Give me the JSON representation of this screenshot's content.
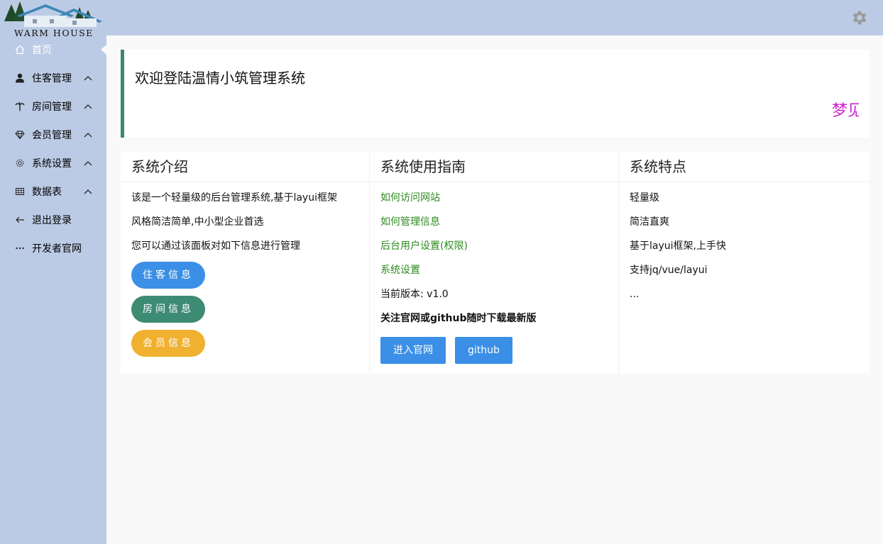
{
  "logo": {
    "text": "WARM HOUSE"
  },
  "sidebar": {
    "items": [
      {
        "label": "首页",
        "icon": "home-icon",
        "active": true
      },
      {
        "label": "住客管理",
        "icon": "user-icon",
        "expandable": true
      },
      {
        "label": "房间管理",
        "icon": "palm-tree-icon",
        "expandable": true
      },
      {
        "label": "会员管理",
        "icon": "diamond-icon",
        "expandable": true
      },
      {
        "label": "系统设置",
        "icon": "gear-icon",
        "expandable": true
      },
      {
        "label": "数据表",
        "icon": "table-icon",
        "expandable": true
      },
      {
        "label": "退出登录",
        "icon": "arrow-left-icon"
      },
      {
        "label": "开发者官网",
        "icon": "more-icon"
      }
    ]
  },
  "header": {
    "settings_icon": "gear-icon"
  },
  "welcome": {
    "title": "欢迎登陆温情小筑管理系统",
    "marquee": "梦见"
  },
  "panels": {
    "intro": {
      "title": "系统介绍",
      "lines": [
        "该是一个轻量级的后台管理系统,基于layui框架",
        "风格简洁简单,中小型企业首选",
        "您可以通过该面板对如下信息进行管理"
      ],
      "buttons": [
        "住客信息",
        "房间信息",
        "会员信息"
      ]
    },
    "guide": {
      "title": "系统使用指南",
      "links": [
        "如何访问网站",
        "如何管理信息",
        "后台用户设置(权限)",
        "系统设置"
      ],
      "version": "当前版本: v1.0",
      "notice": "关注官网或github随时下载最新版",
      "buttons": [
        "进入官网",
        "github"
      ]
    },
    "features": {
      "title": "系统特点",
      "lines": [
        "轻量级",
        "简洁直爽",
        "基于layui框架,上手快",
        "支持jq/vue/layui",
        "..."
      ]
    }
  },
  "colors": {
    "sidebar_bg": "#bccbe5",
    "accent_green": "#3a8a6e",
    "link_green": "#2e8b1f",
    "blue": "#3b8fe6",
    "orange": "#f0b030",
    "magenta": "#cc22cc"
  }
}
